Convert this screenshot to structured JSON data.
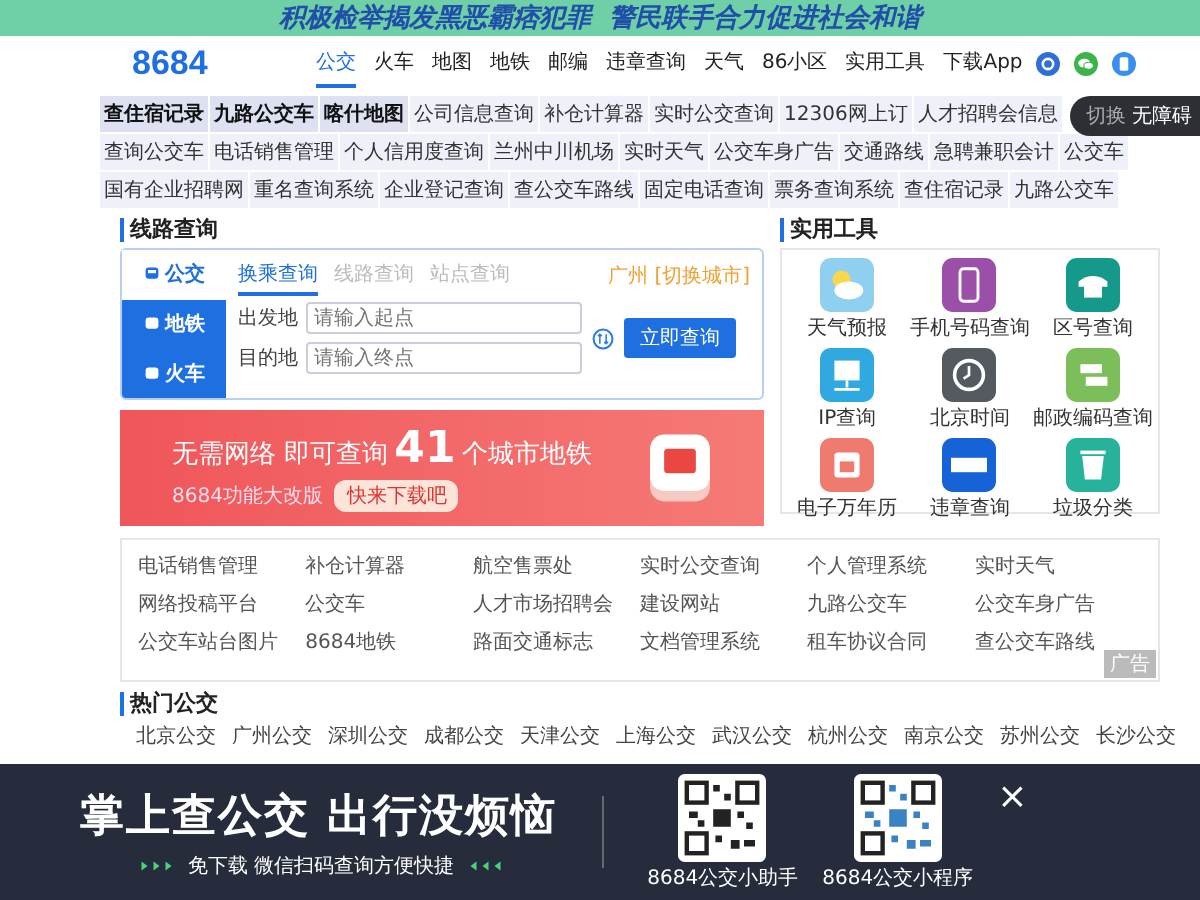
{
  "top_banner": {
    "text": "积极检举揭发黑恶霸痞犯罪  警民联手合力促进社会和谐"
  },
  "header": {
    "logo": "8684",
    "nav": [
      {
        "label": "公交",
        "selected": true
      },
      {
        "label": "火车",
        "selected": false
      },
      {
        "label": "地图",
        "selected": false
      },
      {
        "label": "地铁",
        "selected": false
      },
      {
        "label": "邮编",
        "selected": false
      },
      {
        "label": "违章查询",
        "selected": false
      },
      {
        "label": "天气",
        "selected": false
      },
      {
        "label": "86小区",
        "selected": false
      },
      {
        "label": "实用工具",
        "selected": false
      },
      {
        "label": "下载App",
        "selected": false
      }
    ]
  },
  "accessibility_tab": {
    "prefix": "切换",
    "label": "无障碍"
  },
  "link_grid": [
    [
      {
        "label": "查住宿记录",
        "highlighted": true
      },
      {
        "label": "九路公交车",
        "highlighted": true
      },
      {
        "label": "喀什地图",
        "highlighted": true
      },
      {
        "label": "公司信息查询",
        "highlighted": false
      },
      {
        "label": "补仓计算器",
        "highlighted": false
      },
      {
        "label": "实时公交查询",
        "highlighted": false
      },
      {
        "label": "12306网上订",
        "highlighted": false
      },
      {
        "label": "人才招聘会信息",
        "highlighted": false
      }
    ],
    [
      {
        "label": "查询公交车",
        "highlighted": false
      },
      {
        "label": "电话销售管理",
        "highlighted": false
      },
      {
        "label": "个人信用度查询",
        "highlighted": false
      },
      {
        "label": "兰州中川机场",
        "highlighted": false
      },
      {
        "label": "实时天气",
        "highlighted": false
      },
      {
        "label": "公交车身广告",
        "highlighted": false
      },
      {
        "label": "交通路线",
        "highlighted": false
      },
      {
        "label": "急聘兼职会计",
        "highlighted": false
      },
      {
        "label": "公交车",
        "highlighted": false
      }
    ],
    [
      {
        "label": "国有企业招聘网",
        "highlighted": false
      },
      {
        "label": "重名查询系统",
        "highlighted": false
      },
      {
        "label": "企业登记查询",
        "highlighted": false
      },
      {
        "label": "查公交车路线",
        "highlighted": false
      },
      {
        "label": "固定电话查询",
        "highlighted": false
      },
      {
        "label": "票务查询系统",
        "highlighted": false
      },
      {
        "label": "查住宿记录",
        "highlighted": false
      },
      {
        "label": "九路公交车",
        "highlighted": false
      }
    ]
  ],
  "route_query": {
    "title": "线路查询",
    "modes": [
      {
        "label": "公交",
        "selected": true
      },
      {
        "label": "地铁",
        "selected": false
      },
      {
        "label": "火车",
        "selected": false
      }
    ],
    "tabs": [
      {
        "label": "换乘查询",
        "selected": true
      },
      {
        "label": "线路查询",
        "selected": false
      },
      {
        "label": "站点查询",
        "selected": false
      }
    ],
    "city": "广州 [切换城市]",
    "from_label": "出发地",
    "from_placeholder": "请输入起点",
    "to_label": "目的地",
    "to_placeholder": "请输入终点",
    "submit": "立即查询"
  },
  "promo_banner": {
    "text_before": "无需网络 即可查询",
    "number": "41",
    "text_after": "个城市地铁",
    "note": "8684功能大改版",
    "button": "快来下载吧"
  },
  "tools": {
    "title": "实用工具",
    "items": [
      {
        "label": "天气预报",
        "kind": "weather",
        "color": "#8fd0f0"
      },
      {
        "label": "手机号码查询",
        "kind": "mobile",
        "color": "#9b4fa8"
      },
      {
        "label": "区号查询",
        "kind": "telephone",
        "color": "#14998a"
      },
      {
        "label": "IP查询",
        "kind": "computer",
        "color": "#2fa9e0"
      },
      {
        "label": "北京时间",
        "kind": "clock",
        "color": "#555a60"
      },
      {
        "label": "邮政编码查询",
        "kind": "postcode",
        "color": "#7cbf5a"
      },
      {
        "label": "电子万年历",
        "kind": "calendar",
        "color": "#ee7b6e"
      },
      {
        "label": "违章查询",
        "kind": "traffic",
        "color": "#1563d6"
      },
      {
        "label": "垃圾分类",
        "kind": "trash",
        "color": "#27b29b"
      }
    ]
  },
  "link_table": {
    "rows": [
      [
        "电话销售管理",
        "补仓计算器",
        "航空售票处",
        "实时公交查询",
        "个人管理系统",
        "实时天气"
      ],
      [
        "网络投稿平台",
        "公交车",
        "人才市场招聘会",
        "建设网站",
        "九路公交车",
        "公交车身广告"
      ],
      [
        "公交车站台图片",
        "8684地铁",
        "路面交通标志",
        "文档管理系统",
        "租车协议合同",
        "查公交车路线"
      ]
    ],
    "ad_label": "广告"
  },
  "hot_bus": {
    "title": "热门公交",
    "rows": [
      [
        "北京公交",
        "广州公交",
        "深圳公交",
        "成都公交",
        "天津公交",
        "上海公交",
        "武汉公交",
        "杭州公交",
        "南京公交",
        "苏州公交",
        "长沙公交"
      ]
    ]
  },
  "mini_app_overlay": {
    "headline": "掌上查公交 出行没烦恼",
    "subline": "免下载 微信扫码查询方便快捷",
    "codes": [
      "8684公交小助手",
      "8684公交小程序"
    ],
    "close": "×"
  }
}
